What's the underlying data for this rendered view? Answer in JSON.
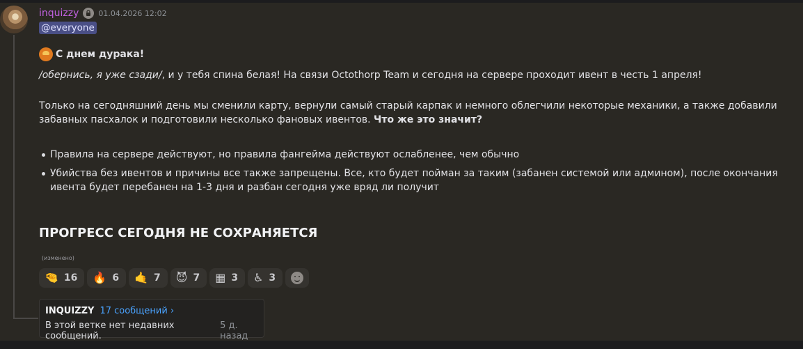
{
  "message": {
    "author": "inquizzy",
    "timestamp": "01.04.2026 12:02",
    "mention": "@everyone",
    "title": "С днем дурака!",
    "intro_italic": "/обернись, я уже сзади/",
    "intro_rest": ", и у тебя спина белая! На связи Octothorp Team и сегодня на сервере проходит ивент в честь 1 апреля!",
    "para2": "Только на сегодняшний день мы сменили карту, вернули самый старый карпак и немного облегчили некоторые механики, а также добавили забавных пасхалок и подготовили несколько фановых ивентов. ",
    "para2_bold": "Что же это значит?",
    "bullets": [
      "Правила на сервере действуют, но правила фангейма действуют ослабленее, чем обычно",
      "Убийства без ивентов и причины все также запрещены. Все, кто будет пойман за таким (забанен системой или админом), после окончания ивента будет перебанен на 1-3 дня и разбан сегодня уже вряд ли получит"
    ],
    "heading": "ПРОГРЕСС СЕГОДНЯ НЕ СОХРАНЯЕТСЯ",
    "edited": "(изменено)"
  },
  "reactions": [
    {
      "icon": "pinch-hand-emoji",
      "glyph": "🤏",
      "count": "16"
    },
    {
      "icon": "fire-emoji",
      "glyph": "🔥",
      "count": "6"
    },
    {
      "icon": "call-me-hand-emoji",
      "glyph": "🤙",
      "count": "7"
    },
    {
      "icon": "smiling-imp-emoji",
      "glyph": "😈",
      "count": "7"
    },
    {
      "icon": "custom-grid-emoji",
      "glyph": "▦",
      "count": "3"
    },
    {
      "icon": "wheelchair-person-emoji",
      "glyph": "♿",
      "count": "3"
    }
  ],
  "thread": {
    "name": "INQUIZZY",
    "count": "17 сообщений ›",
    "message": "В этой ветке нет недавних сообщений.",
    "time": "5 д. назад"
  },
  "colors": {
    "username": "#c061e0",
    "mention_bg": "#4a4f86",
    "thread_link": "#4aa3ff",
    "background": "#2a2823"
  }
}
